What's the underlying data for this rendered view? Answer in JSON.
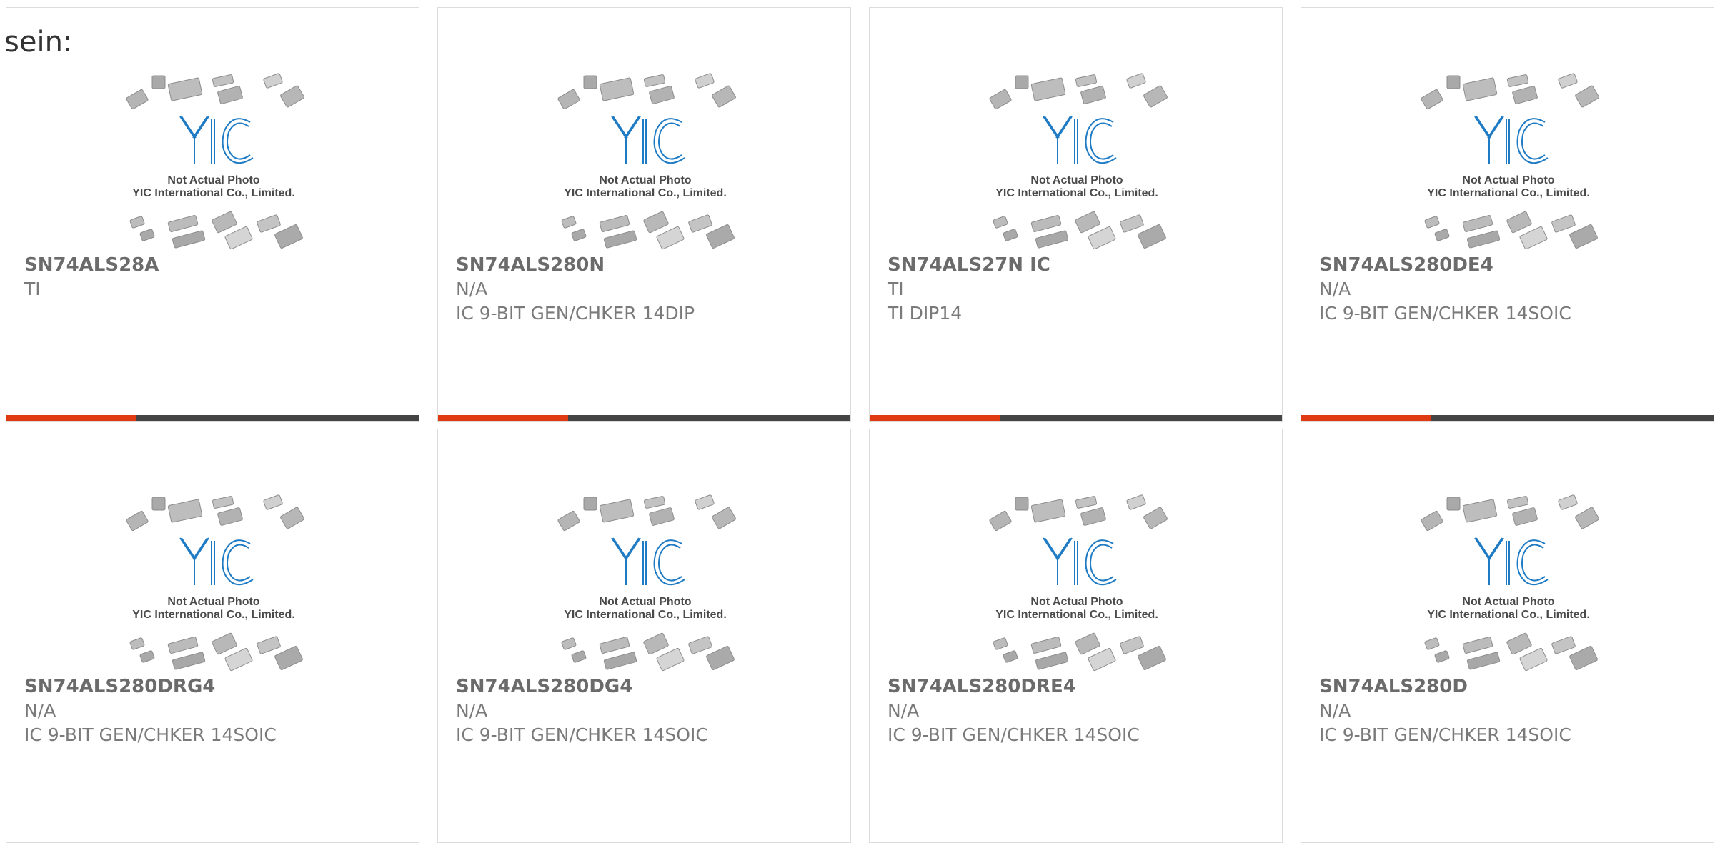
{
  "prefix_text": "sein:",
  "image_caption": {
    "logo": "YIC",
    "line1": "Not Actual Photo",
    "line2": "YIC International Co., Limited."
  },
  "colors": {
    "accent": "#e03a12",
    "bar": "#444444",
    "logo_blue": "#1e7bc4"
  },
  "products": [
    {
      "part": "SN74ALS28A",
      "manufacturer": "TI",
      "description": ""
    },
    {
      "part": "SN74ALS280N",
      "manufacturer": "N/A",
      "description": "IC 9-BIT GEN/CHKER 14DIP"
    },
    {
      "part": "SN74ALS27N IC",
      "manufacturer": "TI",
      "description": "TI DIP14"
    },
    {
      "part": "SN74ALS280DE4",
      "manufacturer": "N/A",
      "description": "IC 9-BIT GEN/CHKER 14SOIC"
    },
    {
      "part": "SN74ALS280DRG4",
      "manufacturer": "N/A",
      "description": "IC 9-BIT GEN/CHKER 14SOIC"
    },
    {
      "part": "SN74ALS280DG4",
      "manufacturer": "N/A",
      "description": "IC 9-BIT GEN/CHKER 14SOIC"
    },
    {
      "part": "SN74ALS280DRE4",
      "manufacturer": "N/A",
      "description": "IC 9-BIT GEN/CHKER 14SOIC"
    },
    {
      "part": "SN74ALS280D",
      "manufacturer": "N/A",
      "description": "IC 9-BIT GEN/CHKER 14SOIC"
    }
  ]
}
